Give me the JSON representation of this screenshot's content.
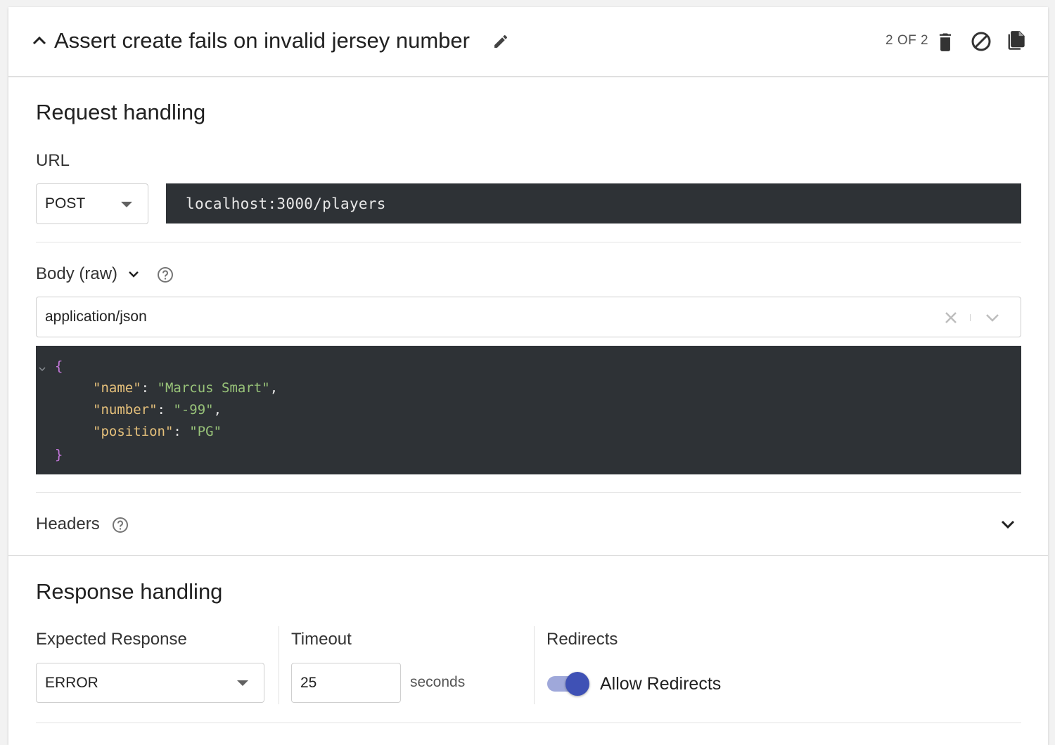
{
  "header": {
    "title": "Assert create fails on invalid jersey number",
    "counter": "2 OF 2",
    "icons": [
      "chevron-up-icon",
      "pencil-icon",
      "trash-icon",
      "disable-icon",
      "copy-icon"
    ]
  },
  "request": {
    "section_title": "Request handling",
    "url_label": "URL",
    "method": "POST",
    "url": "localhost:3000/players",
    "body_label": "Body (raw)",
    "content_type": "application/json",
    "body_code": {
      "name_key": "\"name\"",
      "name_value": "\"Marcus Smart\"",
      "number_key": "\"number\"",
      "number_value": "\"-99\"",
      "position_key": "\"position\"",
      "position_value": "\"PG\""
    },
    "headers_label": "Headers"
  },
  "response": {
    "section_title": "Response handling",
    "expected_label": "Expected Response",
    "expected_value": "ERROR",
    "timeout_label": "Timeout",
    "timeout_value": "25",
    "timeout_unit": "seconds",
    "redirects_label": "Redirects",
    "allow_redirects_label": "Allow Redirects",
    "allow_redirects_enabled": true
  },
  "colors": {
    "toggle_thumb": "#3f51b5",
    "toggle_track": "#9fa8da",
    "code_bg": "#2e3236",
    "json_key": "#e5c07b",
    "json_string": "#98c379",
    "json_brace": "#c678dd"
  }
}
